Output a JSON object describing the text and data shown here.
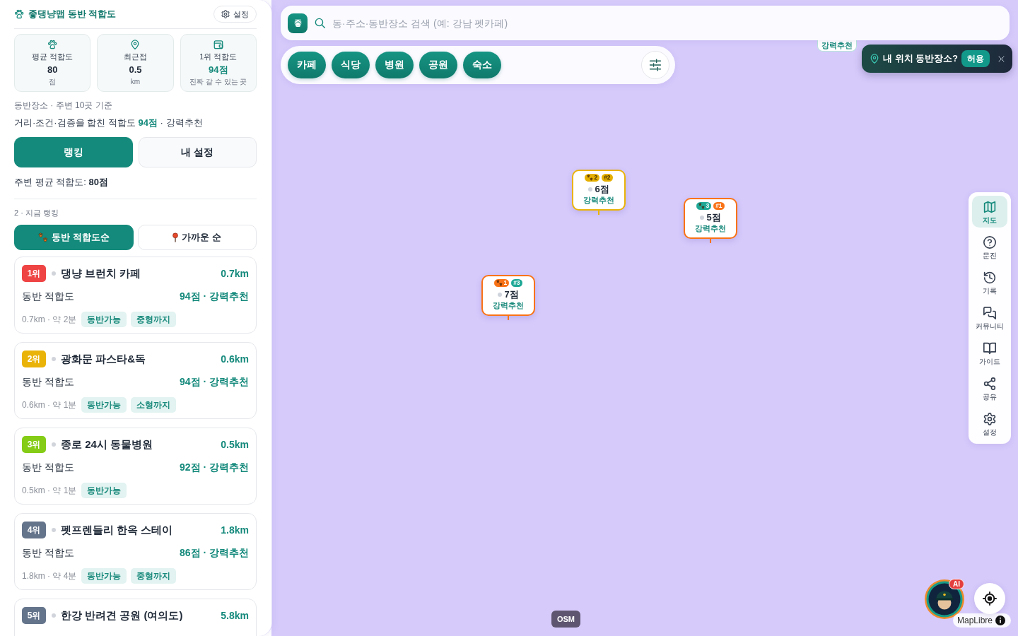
{
  "app": {
    "title": "좋댕냥맵 동반 적합도",
    "settings_button": "설정"
  },
  "stats": [
    {
      "label": "평균 적합도",
      "value": "80",
      "unit": "점",
      "highlight": false
    },
    {
      "label": "최근접",
      "value": "0.5",
      "unit": "km",
      "highlight": false
    },
    {
      "label": "1위 적합도",
      "value": "94점",
      "unit": "진짜 갈 수 있는 곳",
      "highlight": true
    }
  ],
  "basis": "동반장소 · 주변 10곳 기준",
  "summary": "거리·조건·검증을 합친 적합도 **94점** · 강력추천",
  "view_tabs": [
    {
      "label": "랭킹",
      "selected": true
    },
    {
      "label": "내 설정",
      "selected": false
    }
  ],
  "average_note": "주변 평균 적합도: **80점**",
  "ranking_heading": "2 · 지금 랭킹",
  "sort_options": [
    {
      "label": "동반 적합도순",
      "selected": true
    },
    {
      "label": "가까운 순",
      "selected": false
    }
  ],
  "places": [
    {
      "rank": "1위",
      "color": "#ef4444",
      "name": "댕냥 브런치 카페",
      "distance": "0.7km",
      "score_label": "동반 적합도",
      "score": "94점 · 강력추천",
      "meta": "0.7km · 약 2분",
      "tags": [
        "동반가능",
        "중형까지"
      ]
    },
    {
      "rank": "2위",
      "color": "#eab308",
      "name": "광화문 파스타&독",
      "distance": "0.6km",
      "score_label": "동반 적합도",
      "score": "94점 · 강력추천",
      "meta": "0.6km · 약 1분",
      "tags": [
        "동반가능",
        "소형까지"
      ]
    },
    {
      "rank": "3위",
      "color": "#84cc16",
      "name": "종로 24시 동물병원",
      "distance": "0.5km",
      "score_label": "동반 적합도",
      "score": "92점 · 강력추천",
      "meta": "0.5km · 약 1분",
      "tags": [
        "동반가능"
      ]
    },
    {
      "rank": "4위",
      "color": "#64748b",
      "name": "펫프렌들리 한옥 스테이",
      "distance": "1.8km",
      "score_label": "동반 적합도",
      "score": "86점 · 강력추천",
      "meta": "1.8km · 약 4분",
      "tags": [
        "동반가능",
        "중형까지"
      ]
    },
    {
      "rank": "5위",
      "color": "#64748b",
      "name": "한강 반려견 공원 (여의도)",
      "distance": "5.8km"
    }
  ],
  "search": {
    "logo": "좋",
    "placeholder": "동·주소·동반장소 검색 (예: 강남 펫카페)"
  },
  "categories": [
    "카페",
    "식당",
    "병원",
    "공원",
    "숙소"
  ],
  "map_markers": [
    {
      "kind": "covered",
      "label": "강력추천"
    },
    {
      "kind": "full",
      "color": "#eab308",
      "badges": [
        {
          "kind": "count",
          "text": "2",
          "color": "#e6b000"
        },
        {
          "kind": "rank",
          "text": "#2",
          "color": "#e6b000"
        }
      ],
      "score": "6점",
      "label": "강력추천"
    },
    {
      "kind": "full",
      "color": "#f97316",
      "badges": [
        {
          "kind": "count",
          "text": "3",
          "color": "#1fa896"
        },
        {
          "kind": "rank",
          "text": "#1",
          "color": "#f97316"
        }
      ],
      "score": "5점",
      "label": "강력추천"
    },
    {
      "kind": "full",
      "color": "#f97316",
      "badges": [
        {
          "kind": "count",
          "text": "1",
          "color": "#f97316"
        },
        {
          "kind": "rank",
          "text": "#3",
          "color": "#1fa896"
        }
      ],
      "score": "7점",
      "label": "강력추천"
    }
  ],
  "location_prompt": {
    "text": "내 위치 동반장소?",
    "allow_button": "허용"
  },
  "nav": [
    {
      "label": "지도",
      "selected": true
    },
    {
      "label": "문진",
      "selected": false
    },
    {
      "label": "기록",
      "selected": false
    },
    {
      "label": "커뮤니티",
      "selected": false
    },
    {
      "label": "가이드",
      "selected": false
    },
    {
      "label": "공유",
      "selected": false
    },
    {
      "label": "설정",
      "selected": false
    }
  ],
  "tile_source": "OSM",
  "assistant_badge": "AI",
  "attribution": "MapLibre"
}
